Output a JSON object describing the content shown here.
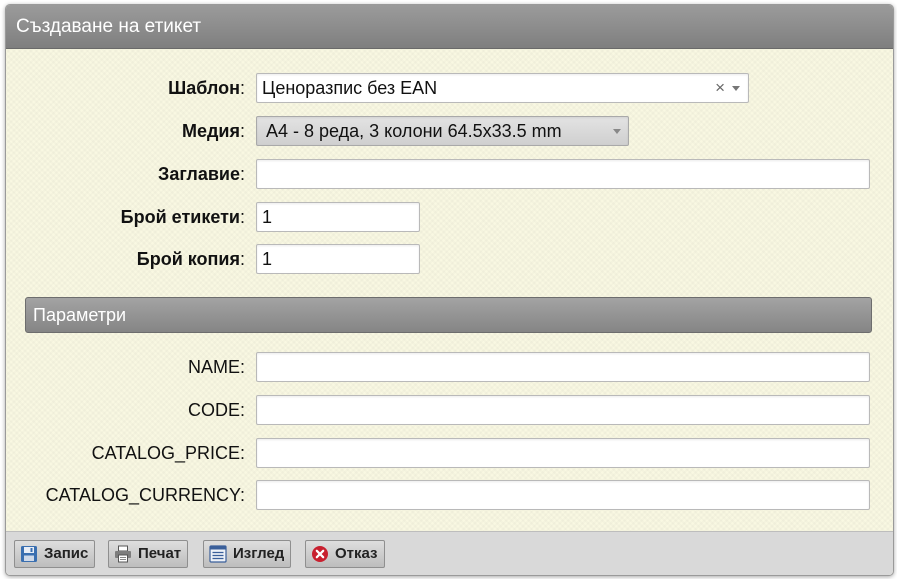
{
  "dialog": {
    "title": "Създаване на етикет"
  },
  "form": {
    "template_label": "Шаблон",
    "template_value": "Ценоразпис без EAN",
    "template_clear": "×",
    "media_label": "Медия",
    "media_value": "A4 - 8 реда, 3 колони 64.5x33.5 mm",
    "title_label": "Заглавие",
    "title_value": "",
    "label_count_label": "Брой етикети",
    "label_count_value": "1",
    "copies_label": "Брой копия",
    "copies_value": "1"
  },
  "parameters": {
    "header": "Параметри",
    "fields": [
      {
        "label": "NAME",
        "value": ""
      },
      {
        "label": "CODE",
        "value": ""
      },
      {
        "label": "CATALOG_PRICE",
        "value": ""
      },
      {
        "label": "CATALOG_CURRENCY",
        "value": ""
      }
    ]
  },
  "buttons": {
    "save": "Запис",
    "print": "Печат",
    "preview": "Изглед",
    "cancel": "Отказ"
  },
  "icons": {
    "save": "floppy-disk-icon",
    "print": "printer-icon",
    "preview": "list-view-icon",
    "cancel": "cancel-x-icon"
  },
  "colors": {
    "titlebar": "#8c8c8c",
    "form_background": "#f9f8e2",
    "footer": "#d9d9d9",
    "cancel_icon": "#c8202f"
  }
}
